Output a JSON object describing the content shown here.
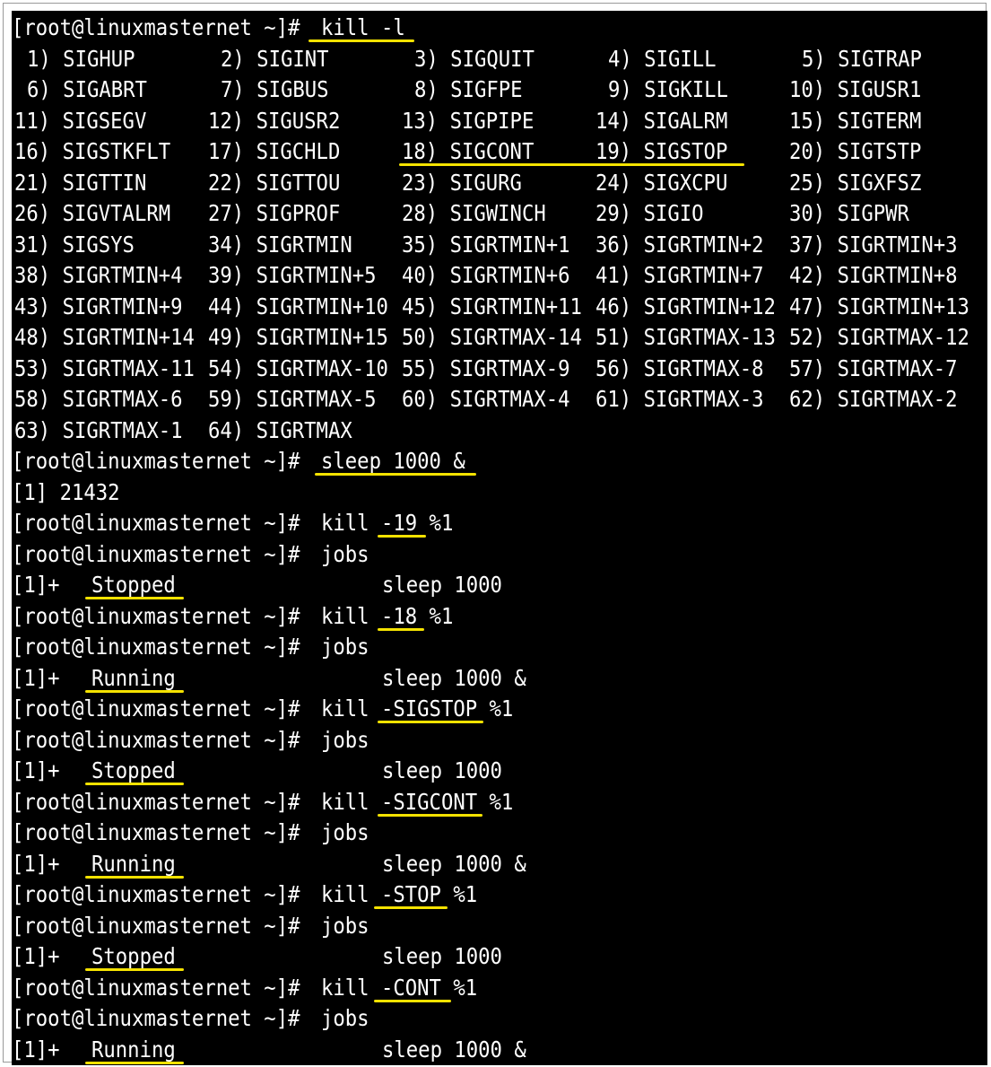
{
  "colors": {
    "background": "#000000",
    "text": "#ffffff",
    "highlight": "#f4e200",
    "frame_border": "#9a9a9a"
  },
  "prompt": "[root@linuxmasternet ~]#",
  "kill_list_command": "kill -l",
  "signals": [
    "1) SIGHUP",
    "2) SIGINT",
    "3) SIGQUIT",
    "4) SIGILL",
    "5) SIGTRAP",
    "6) SIGABRT",
    "7) SIGBUS",
    "8) SIGFPE",
    "9) SIGKILL",
    "10) SIGUSR1",
    "11) SIGSEGV",
    "12) SIGUSR2",
    "13) SIGPIPE",
    "14) SIGALRM",
    "15) SIGTERM",
    "16) SIGSTKFLT",
    "17) SIGCHLD",
    "18) SIGCONT",
    "19) SIGSTOP",
    "20) SIGTSTP",
    "21) SIGTTIN",
    "22) SIGTTOU",
    "23) SIGURG",
    "24) SIGXCPU",
    "25) SIGXFSZ",
    "26) SIGVTALRM",
    "27) SIGPROF",
    "28) SIGWINCH",
    "29) SIGIO",
    "30) SIGPWR",
    "31) SIGSYS",
    "34) SIGRTMIN",
    "35) SIGRTMIN+1",
    "36) SIGRTMIN+2",
    "37) SIGRTMIN+3",
    "38) SIGRTMIN+4",
    "39) SIGRTMIN+5",
    "40) SIGRTMIN+6",
    "41) SIGRTMIN+7",
    "42) SIGRTMIN+8",
    "43) SIGRTMIN+9",
    "44) SIGRTMIN+10",
    "45) SIGRTMIN+11",
    "46) SIGRTMIN+12",
    "47) SIGRTMIN+13",
    "48) SIGRTMIN+14",
    "49) SIGRTMIN+15",
    "50) SIGRTMAX-14",
    "51) SIGRTMAX-13",
    "52) SIGRTMAX-12",
    "53) SIGRTMAX-11",
    "54) SIGRTMAX-10",
    "55) SIGRTMAX-9",
    "56) SIGRTMAX-8",
    "57) SIGRTMAX-7",
    "58) SIGRTMAX-6",
    "59) SIGRTMAX-5",
    "60) SIGRTMAX-4",
    "61) SIGRTMAX-3",
    "62) SIGRTMAX-2",
    "63) SIGRTMAX-1",
    "64) SIGRTMAX"
  ],
  "session": [
    {
      "type": "cmd",
      "text": "sleep 1000 &"
    },
    {
      "type": "out",
      "text": "[1] 21432"
    },
    {
      "type": "cmd",
      "text": "kill -19 %1"
    },
    {
      "type": "cmd",
      "text": "jobs"
    },
    {
      "type": "job",
      "id": "[1]+",
      "status": "Stopped",
      "command": "sleep 1000"
    },
    {
      "type": "cmd",
      "text": "kill -18 %1"
    },
    {
      "type": "cmd",
      "text": "jobs"
    },
    {
      "type": "job",
      "id": "[1]+",
      "status": "Running",
      "command": "sleep 1000 &"
    },
    {
      "type": "cmd",
      "text": "kill -SIGSTOP %1"
    },
    {
      "type": "cmd",
      "text": "jobs"
    },
    {
      "type": "job",
      "id": "[1]+",
      "status": "Stopped",
      "command": "sleep 1000"
    },
    {
      "type": "cmd",
      "text": "kill -SIGCONT %1"
    },
    {
      "type": "cmd",
      "text": "jobs"
    },
    {
      "type": "job",
      "id": "[1]+",
      "status": "Running",
      "command": "sleep 1000 &"
    },
    {
      "type": "cmd",
      "text": "kill -STOP %1"
    },
    {
      "type": "cmd",
      "text": "jobs"
    },
    {
      "type": "job",
      "id": "[1]+",
      "status": "Stopped",
      "command": "sleep 1000"
    },
    {
      "type": "cmd",
      "text": "kill -CONT %1"
    },
    {
      "type": "cmd",
      "text": "jobs"
    },
    {
      "type": "job",
      "id": "[1]+",
      "status": "Running",
      "command": "sleep 1000 &"
    }
  ]
}
